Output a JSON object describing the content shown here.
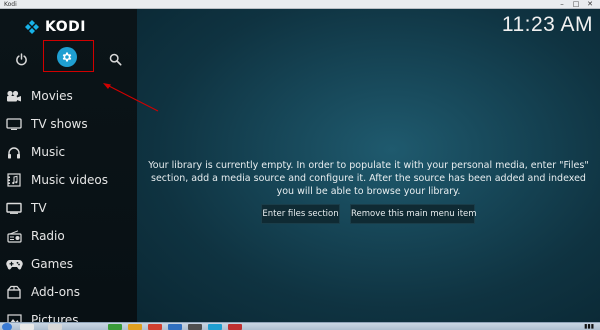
{
  "window": {
    "title": "Kodi"
  },
  "app": {
    "name": "KODI",
    "clock": "11:23 AM"
  },
  "topbar": {
    "power_icon": "power-icon",
    "settings_icon": "gear-icon",
    "search_icon": "search-icon"
  },
  "menu": {
    "items": [
      {
        "label": "Movies",
        "icon": "film-icon"
      },
      {
        "label": "TV shows",
        "icon": "tv-icon"
      },
      {
        "label": "Music",
        "icon": "headphones-icon"
      },
      {
        "label": "Music videos",
        "icon": "music-video-icon"
      },
      {
        "label": "TV",
        "icon": "television-icon"
      },
      {
        "label": "Radio",
        "icon": "radio-icon"
      },
      {
        "label": "Games",
        "icon": "gamepad-icon"
      },
      {
        "label": "Add-ons",
        "icon": "addons-icon"
      },
      {
        "label": "Pictures",
        "icon": "pictures-icon"
      }
    ]
  },
  "main": {
    "message": "Your library is currently empty. In order to populate it with your personal media, enter \"Files\" section, add a media source and configure it. After the source has been added and indexed you will be able to browse your library.",
    "enter_files_label": "Enter files section",
    "remove_item_label": "Remove this main menu item"
  },
  "annotation": {
    "color": "#d10000"
  },
  "colors": {
    "accent": "#1f9fd1",
    "background": "#164556"
  }
}
